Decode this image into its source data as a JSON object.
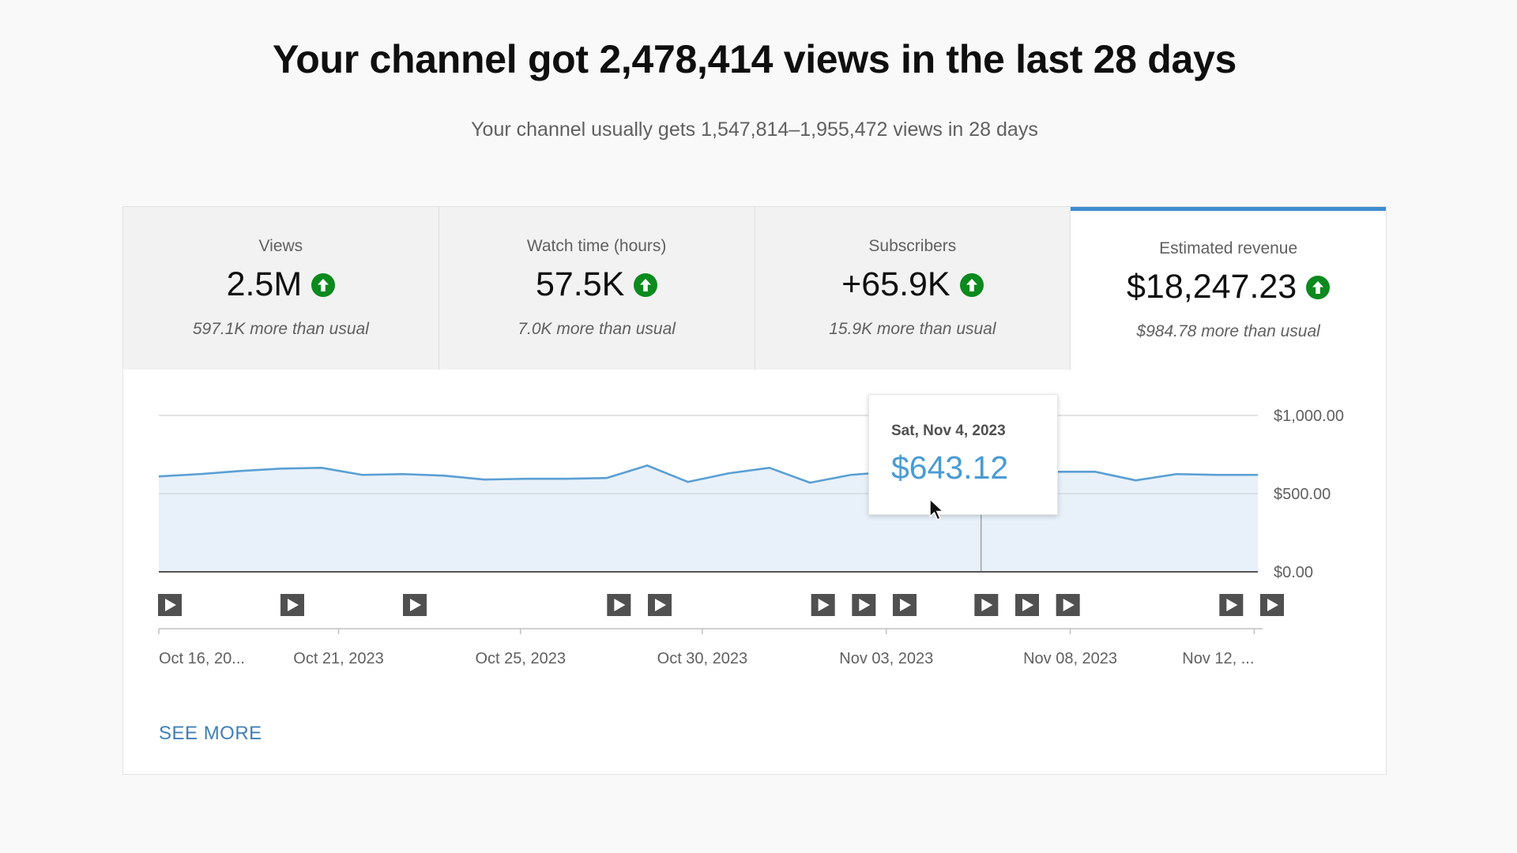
{
  "headline": "Your channel got 2,478,414 views in the last 28 days",
  "subheadline": "Your channel usually gets 1,547,814–1,955,472 views in 28 days",
  "tabs": [
    {
      "label": "Views",
      "value": "2.5M",
      "note": "597.1K more than usual",
      "trend_icon": "arrow-up-circle-icon"
    },
    {
      "label": "Watch time (hours)",
      "value": "57.5K",
      "note": "7.0K more than usual",
      "trend_icon": "arrow-up-circle-icon"
    },
    {
      "label": "Subscribers",
      "value": "+65.9K",
      "note": "15.9K more than usual",
      "trend_icon": "arrow-up-circle-icon"
    },
    {
      "label": "Estimated revenue",
      "value": "$18,247.23",
      "note": "$984.78 more than usual",
      "trend_icon": "arrow-up-circle-icon",
      "selected": true
    }
  ],
  "tooltip": {
    "date": "Sat, Nov 4, 2023",
    "value": "$643.12"
  },
  "see_more": "SEE MORE",
  "colors": {
    "accent": "#3e8ed0",
    "line": "#5a9fd4",
    "area": "#e8f1f9",
    "trend_up": "#0b8a1e",
    "tooltip_value": "#4a9bd3"
  },
  "chart_data": {
    "type": "area",
    "x": [
      "Oct 16, 2023",
      "Oct 17, 2023",
      "Oct 18, 2023",
      "Oct 19, 2023",
      "Oct 20, 2023",
      "Oct 21, 2023",
      "Oct 22, 2023",
      "Oct 23, 2023",
      "Oct 24, 2023",
      "Oct 25, 2023",
      "Oct 26, 2023",
      "Oct 27, 2023",
      "Oct 28, 2023",
      "Oct 29, 2023",
      "Oct 30, 2023",
      "Oct 31, 2023",
      "Nov 01, 2023",
      "Nov 02, 2023",
      "Nov 03, 2023",
      "Nov 04, 2023",
      "Nov 05, 2023",
      "Nov 06, 2023",
      "Nov 07, 2023",
      "Nov 08, 2023",
      "Nov 09, 2023",
      "Nov 10, 2023",
      "Nov 11, 2023",
      "Nov 12, 2023"
    ],
    "values": [
      610,
      625,
      645,
      660,
      665,
      620,
      625,
      615,
      590,
      595,
      595,
      600,
      680,
      575,
      630,
      665,
      570,
      620,
      640,
      643.12,
      605,
      595,
      640,
      640,
      585,
      625,
      620,
      620
    ],
    "series": [
      {
        "values": [
          610,
          625,
          645,
          660,
          665,
          620,
          625,
          615,
          590,
          595,
          595,
          600,
          680,
          575,
          630,
          665,
          570,
          620,
          640,
          643.12,
          605,
          595,
          640,
          640,
          585,
          625,
          620,
          620
        ]
      }
    ],
    "ylim": [
      0,
      1000
    ],
    "yticks": [
      "$0.00",
      "$500.00",
      "$1,000.00"
    ],
    "ytick_values": [
      0,
      500,
      1000
    ],
    "xtick_labels": [
      "Oct 16, 20...",
      "Oct 21, 2023",
      "Oct 25, 2023",
      "Oct 30, 2023",
      "Nov 03, 2023",
      "Nov 08, 2023",
      "Nov 12, ..."
    ],
    "xtick_indices": [
      0,
      4.3,
      8.65,
      13,
      17.4,
      21.8,
      26.2
    ],
    "video_markers_indices": [
      0,
      3,
      6,
      11,
      12,
      16,
      17,
      18,
      20,
      21,
      22,
      26,
      27
    ],
    "hover_index": 20.2,
    "grid": true,
    "title": "",
    "xlabel": "",
    "ylabel": ""
  }
}
